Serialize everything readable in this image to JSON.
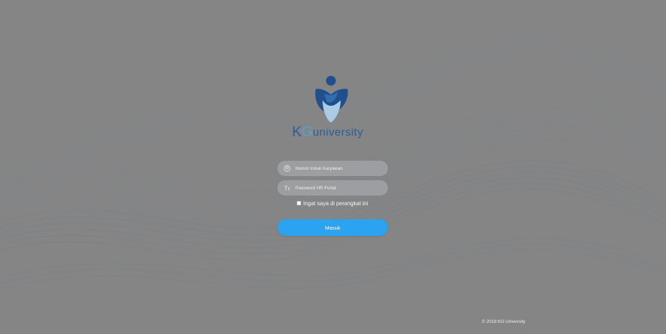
{
  "brand": {
    "name": "KG university",
    "colors": {
      "blue_dark": "#1f4f8c",
      "blue_light": "#4fa3d6",
      "accent": "#2ba3f0",
      "background": "#858585"
    }
  },
  "login": {
    "username": {
      "placeholder": "Nomor Induk Karyawan",
      "value": "",
      "icon": "user-circle-icon"
    },
    "password": {
      "placeholder": "Password HR Portal",
      "value": "",
      "icon": "text-size-icon"
    },
    "remember": {
      "label": "Ingat saya di perangkat ini",
      "checked": false
    },
    "submit_label": "Masuk"
  },
  "footer": {
    "copyright": "© 2018 KG University"
  }
}
